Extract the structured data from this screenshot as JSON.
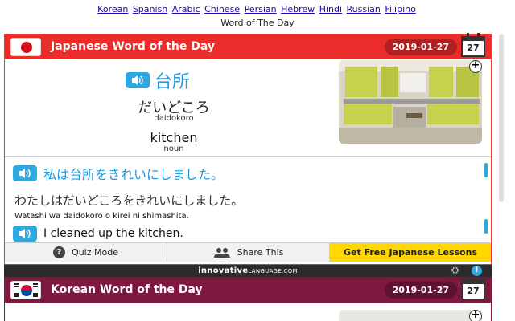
{
  "top": {
    "languages": [
      "Korean",
      "Spanish",
      "Arabic",
      "Chinese",
      "Persian",
      "Hebrew",
      "Hindi",
      "Russian",
      "Filipino"
    ],
    "subtitle": "Word of The Day"
  },
  "japanese": {
    "title": "Japanese Word of the Day",
    "date": "2019-01-27",
    "calendar_day": "27",
    "word": "台所",
    "kana": "だいどころ",
    "romaji": "daidokoro",
    "english": "kitchen",
    "part_of_speech": "noun",
    "sentence_jp": "私は台所をきれいにしました。",
    "sentence_kana": "わたしはだいどころをきれいにしました。",
    "sentence_romaji": "Watashi wa daidokoro o kirei ni shimashita.",
    "sentence_en": "I cleaned up the kitchen.",
    "accent_color": "#ec2b2b"
  },
  "actions": {
    "quiz": "Quiz Mode",
    "share": "Share This",
    "free": "Get Free Japanese Lessons"
  },
  "brand": {
    "bold": "innovative",
    "light": "LANGUAGE.COM"
  },
  "korean": {
    "title": "Korean Word of the Day",
    "date": "2019-01-27",
    "calendar_day": "27",
    "accent_color": "#7d1940"
  },
  "icons": [
    "speaker-icon",
    "plus-icon",
    "quiz-icon",
    "share-icon",
    "gear-icon",
    "info-icon",
    "calendar-icon"
  ]
}
